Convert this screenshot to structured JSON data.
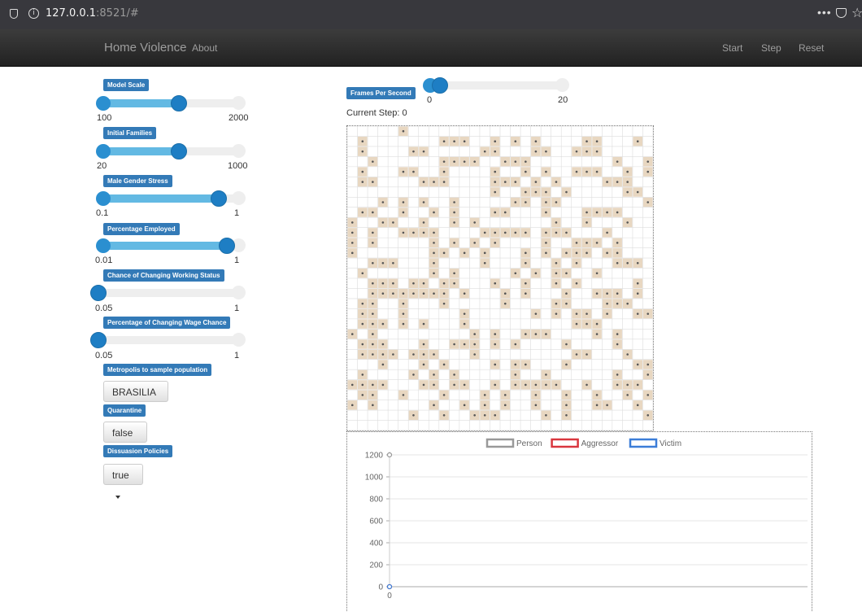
{
  "browser": {
    "url_host": "127.0.0.1",
    "url_port_path": ":8521/#"
  },
  "navbar": {
    "brand": "Home Violence",
    "about": "About",
    "start": "Start",
    "step": "Step",
    "reset": "Reset"
  },
  "params": {
    "model_scale": {
      "label": "Model Scale",
      "min": "100",
      "max": "2000",
      "fraction": 0.55
    },
    "initial_families": {
      "label": "Initial Families",
      "min": "20",
      "max": "1000",
      "fraction": 0.55
    },
    "male_gender_stress": {
      "label": "Male Gender Stress",
      "min": "0.1",
      "max": "1",
      "fraction": 0.82
    },
    "percentage_employed": {
      "label": "Percentage Employed",
      "min": "0.01",
      "max": "1",
      "fraction": 0.88
    },
    "chance_changing_working_status": {
      "label": "Chance of Changing Working Status",
      "min": "0.05",
      "max": "1",
      "fraction": 0.0
    },
    "percentage_changing_wage": {
      "label": "Percentage of Changing Wage Chance",
      "min": "0.05",
      "max": "1",
      "fraction": 0.0
    },
    "metropolis": {
      "label": "Metropolis to sample population",
      "value": "BRASILIA"
    },
    "quarantine": {
      "label": "Quarantine",
      "value": "false"
    },
    "dissuasion": {
      "label": "Dissuasion Policies",
      "value": "true"
    }
  },
  "fps": {
    "label": "Frames Per Second",
    "min": "0",
    "max": "20",
    "fraction": 0.1
  },
  "current_step": "Current Step: 0",
  "grid": {
    "cols": 30,
    "rows": 30,
    "agent_color": "#e8d7c1",
    "grid_line_color": "#dddddd",
    "occupied": [
      [
        1,
        1
      ],
      [
        3,
        2
      ],
      [
        0,
        5
      ],
      [
        1,
        9
      ],
      [
        1,
        10
      ],
      [
        1,
        11
      ],
      [
        1,
        14
      ],
      [
        2,
        13
      ],
      [
        2,
        14
      ],
      [
        1,
        16
      ],
      [
        1,
        18
      ],
      [
        2,
        18
      ],
      [
        2,
        22
      ],
      [
        2,
        23
      ],
      [
        1,
        23
      ],
      [
        1,
        24
      ],
      [
        2,
        24
      ],
      [
        1,
        28
      ],
      [
        2,
        1
      ],
      [
        2,
        6
      ],
      [
        2,
        7
      ],
      [
        3,
        9
      ],
      [
        3,
        10
      ],
      [
        3,
        11
      ],
      [
        3,
        12
      ],
      [
        3,
        15
      ],
      [
        3,
        16
      ],
      [
        3,
        17
      ],
      [
        2,
        19
      ],
      [
        4,
        19
      ],
      [
        4,
        23
      ],
      [
        4,
        24
      ],
      [
        3,
        26
      ],
      [
        3,
        29
      ],
      [
        4,
        1
      ],
      [
        5,
        1
      ],
      [
        5,
        2
      ],
      [
        4,
        5
      ],
      [
        4,
        6
      ],
      [
        4,
        9
      ],
      [
        4,
        14
      ],
      [
        4,
        17
      ],
      [
        4,
        22
      ],
      [
        4,
        27
      ],
      [
        4,
        29
      ],
      [
        5,
        7
      ],
      [
        5,
        8
      ],
      [
        5,
        9
      ],
      [
        5,
        14
      ],
      [
        5,
        15
      ],
      [
        5,
        16
      ],
      [
        5,
        18
      ],
      [
        5,
        20
      ],
      [
        5,
        25
      ],
      [
        5,
        26
      ],
      [
        5,
        27
      ],
      [
        6,
        14
      ],
      [
        6,
        17
      ],
      [
        6,
        18
      ],
      [
        6,
        19
      ],
      [
        6,
        21
      ],
      [
        6,
        27
      ],
      [
        6,
        28
      ],
      [
        7,
        3
      ],
      [
        7,
        5
      ],
      [
        7,
        7
      ],
      [
        7,
        10
      ],
      [
        7,
        16
      ],
      [
        7,
        17
      ],
      [
        7,
        19
      ],
      [
        7,
        20
      ],
      [
        7,
        29
      ],
      [
        8,
        1
      ],
      [
        8,
        2
      ],
      [
        8,
        5
      ],
      [
        8,
        8
      ],
      [
        8,
        10
      ],
      [
        8,
        14
      ],
      [
        8,
        15
      ],
      [
        8,
        19
      ],
      [
        8,
        23
      ],
      [
        8,
        24
      ],
      [
        8,
        25
      ],
      [
        8,
        26
      ],
      [
        9,
        0
      ],
      [
        9,
        3
      ],
      [
        9,
        4
      ],
      [
        9,
        7
      ],
      [
        9,
        10
      ],
      [
        9,
        12
      ],
      [
        9,
        20
      ],
      [
        9,
        23
      ],
      [
        9,
        27
      ],
      [
        10,
        0
      ],
      [
        10,
        2
      ],
      [
        10,
        5
      ],
      [
        10,
        6
      ],
      [
        10,
        7
      ],
      [
        10,
        8
      ],
      [
        10,
        13
      ],
      [
        10,
        14
      ],
      [
        10,
        15
      ],
      [
        10,
        16
      ],
      [
        10,
        17
      ],
      [
        10,
        19
      ],
      [
        10,
        20
      ],
      [
        10,
        21
      ],
      [
        10,
        25
      ],
      [
        11,
        0
      ],
      [
        11,
        2
      ],
      [
        11,
        8
      ],
      [
        11,
        10
      ],
      [
        11,
        12
      ],
      [
        11,
        14
      ],
      [
        11,
        19
      ],
      [
        11,
        22
      ],
      [
        11,
        23
      ],
      [
        11,
        24
      ],
      [
        11,
        26
      ],
      [
        12,
        0
      ],
      [
        12,
        8
      ],
      [
        12,
        9
      ],
      [
        12,
        11
      ],
      [
        12,
        13
      ],
      [
        12,
        17
      ],
      [
        12,
        19
      ],
      [
        12,
        21
      ],
      [
        12,
        22
      ],
      [
        12,
        23
      ],
      [
        12,
        25
      ],
      [
        12,
        26
      ],
      [
        13,
        2
      ],
      [
        13,
        3
      ],
      [
        13,
        4
      ],
      [
        13,
        8
      ],
      [
        13,
        13
      ],
      [
        13,
        17
      ],
      [
        13,
        20
      ],
      [
        13,
        22
      ],
      [
        13,
        26
      ],
      [
        13,
        27
      ],
      [
        13,
        28
      ],
      [
        14,
        1
      ],
      [
        14,
        8
      ],
      [
        14,
        10
      ],
      [
        14,
        16
      ],
      [
        14,
        18
      ],
      [
        14,
        20
      ],
      [
        14,
        21
      ],
      [
        14,
        24
      ],
      [
        15,
        2
      ],
      [
        15,
        3
      ],
      [
        15,
        4
      ],
      [
        15,
        6
      ],
      [
        15,
        7
      ],
      [
        15,
        9
      ],
      [
        15,
        10
      ],
      [
        15,
        14
      ],
      [
        15,
        17
      ],
      [
        15,
        20
      ],
      [
        15,
        22
      ],
      [
        15,
        28
      ],
      [
        16,
        2
      ],
      [
        16,
        3
      ],
      [
        16,
        4
      ],
      [
        16,
        5
      ],
      [
        16,
        6
      ],
      [
        16,
        7
      ],
      [
        16,
        8
      ],
      [
        16,
        9
      ],
      [
        16,
        11
      ],
      [
        16,
        15
      ],
      [
        16,
        17
      ],
      [
        16,
        21
      ],
      [
        16,
        24
      ],
      [
        16,
        25
      ],
      [
        16,
        26
      ],
      [
        16,
        28
      ],
      [
        17,
        1
      ],
      [
        17,
        2
      ],
      [
        17,
        5
      ],
      [
        17,
        9
      ],
      [
        17,
        15
      ],
      [
        17,
        20
      ],
      [
        17,
        21
      ],
      [
        17,
        25
      ],
      [
        17,
        26
      ],
      [
        17,
        27
      ],
      [
        18,
        1
      ],
      [
        18,
        2
      ],
      [
        18,
        5
      ],
      [
        18,
        11
      ],
      [
        18,
        18
      ],
      [
        18,
        20
      ],
      [
        18,
        22
      ],
      [
        18,
        23
      ],
      [
        18,
        25
      ],
      [
        18,
        28
      ],
      [
        18,
        29
      ],
      [
        19,
        1
      ],
      [
        19,
        2
      ],
      [
        19,
        3
      ],
      [
        19,
        5
      ],
      [
        19,
        7
      ],
      [
        19,
        11
      ],
      [
        19,
        22
      ],
      [
        19,
        23
      ],
      [
        19,
        24
      ],
      [
        20,
        0
      ],
      [
        20,
        2
      ],
      [
        20,
        12
      ],
      [
        20,
        14
      ],
      [
        20,
        17
      ],
      [
        20,
        18
      ],
      [
        20,
        19
      ],
      [
        20,
        24
      ],
      [
        20,
        26
      ],
      [
        21,
        1
      ],
      [
        21,
        2
      ],
      [
        21,
        3
      ],
      [
        21,
        7
      ],
      [
        21,
        10
      ],
      [
        21,
        11
      ],
      [
        21,
        12
      ],
      [
        21,
        14
      ],
      [
        21,
        16
      ],
      [
        21,
        21
      ],
      [
        21,
        26
      ],
      [
        22,
        1
      ],
      [
        22,
        2
      ],
      [
        22,
        3
      ],
      [
        22,
        4
      ],
      [
        22,
        6
      ],
      [
        22,
        7
      ],
      [
        22,
        8
      ],
      [
        22,
        12
      ],
      [
        22,
        22
      ],
      [
        22,
        23
      ],
      [
        22,
        27
      ],
      [
        23,
        3
      ],
      [
        23,
        7
      ],
      [
        23,
        9
      ],
      [
        23,
        14
      ],
      [
        23,
        16
      ],
      [
        23,
        17
      ],
      [
        23,
        21
      ],
      [
        23,
        28
      ],
      [
        23,
        29
      ],
      [
        24,
        1
      ],
      [
        24,
        6
      ],
      [
        24,
        8
      ],
      [
        24,
        10
      ],
      [
        24,
        16
      ],
      [
        24,
        19
      ],
      [
        24,
        26
      ],
      [
        24,
        29
      ],
      [
        25,
        0
      ],
      [
        25,
        1
      ],
      [
        25,
        2
      ],
      [
        25,
        3
      ],
      [
        25,
        7
      ],
      [
        25,
        8
      ],
      [
        25,
        10
      ],
      [
        25,
        11
      ],
      [
        25,
        14
      ],
      [
        25,
        16
      ],
      [
        25,
        17
      ],
      [
        25,
        18
      ],
      [
        25,
        19
      ],
      [
        25,
        20
      ],
      [
        25,
        23
      ],
      [
        25,
        26
      ],
      [
        25,
        27
      ],
      [
        25,
        28
      ],
      [
        26,
        1
      ],
      [
        26,
        2
      ],
      [
        26,
        5
      ],
      [
        26,
        9
      ],
      [
        26,
        13
      ],
      [
        26,
        15
      ],
      [
        26,
        18
      ],
      [
        26,
        21
      ],
      [
        26,
        24
      ],
      [
        26,
        27
      ],
      [
        26,
        29
      ],
      [
        27,
        0
      ],
      [
        27,
        2
      ],
      [
        27,
        8
      ],
      [
        27,
        11
      ],
      [
        27,
        13
      ],
      [
        27,
        15
      ],
      [
        27,
        18
      ],
      [
        27,
        21
      ],
      [
        27,
        24
      ],
      [
        27,
        25
      ],
      [
        27,
        28
      ],
      [
        28,
        6
      ],
      [
        28,
        9
      ],
      [
        28,
        12
      ],
      [
        28,
        13
      ],
      [
        28,
        14
      ],
      [
        28,
        19
      ],
      [
        28,
        21
      ],
      [
        28,
        29
      ]
    ]
  },
  "chart_data": {
    "type": "line",
    "title": "",
    "xlabel": "",
    "ylabel": "",
    "ylim": [
      0,
      1200
    ],
    "yticks": [
      "1200",
      "1000",
      "800",
      "600",
      "400",
      "200",
      "0"
    ],
    "xticks": [
      "0"
    ],
    "legend_position": "top",
    "series": [
      {
        "name": "Person",
        "color": "#999999",
        "x": [
          0
        ],
        "values": [
          1200
        ]
      },
      {
        "name": "Aggressor",
        "color": "#d9363e",
        "x": [
          0
        ],
        "values": [
          0
        ]
      },
      {
        "name": "Victim",
        "color": "#3b7dd8",
        "x": [
          0
        ],
        "values": [
          0
        ]
      }
    ]
  }
}
